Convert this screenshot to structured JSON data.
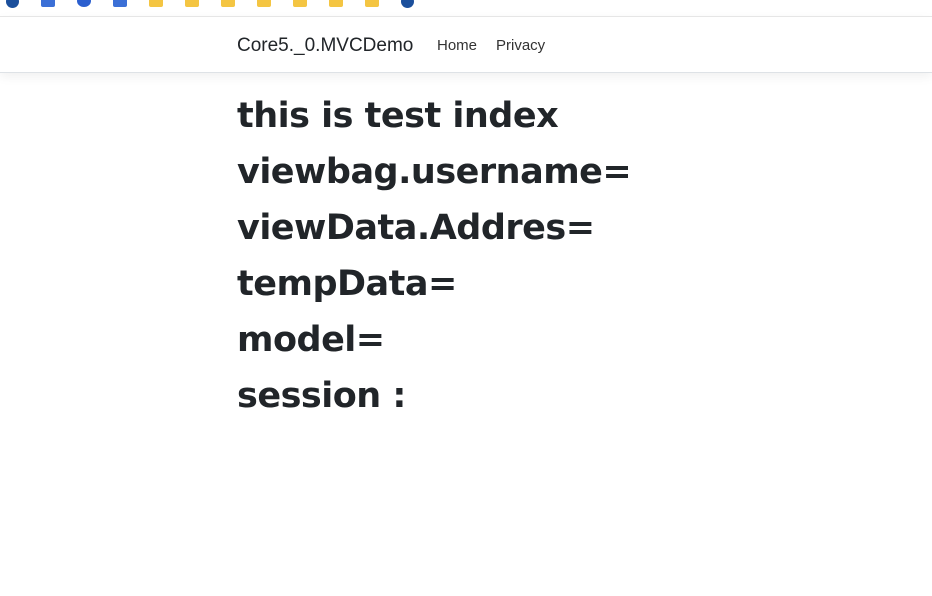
{
  "navbar": {
    "brand": "Core5._0.MVCDemo",
    "links": [
      "Home",
      "Privacy"
    ]
  },
  "main": {
    "lines": [
      "this is test index",
      "viewbag.username=",
      "viewData.Addres=",
      "tempData=",
      "model=",
      "session :"
    ]
  },
  "colors": {
    "text": "#212529",
    "folder": "#f4c542",
    "background": "#ffffff"
  }
}
